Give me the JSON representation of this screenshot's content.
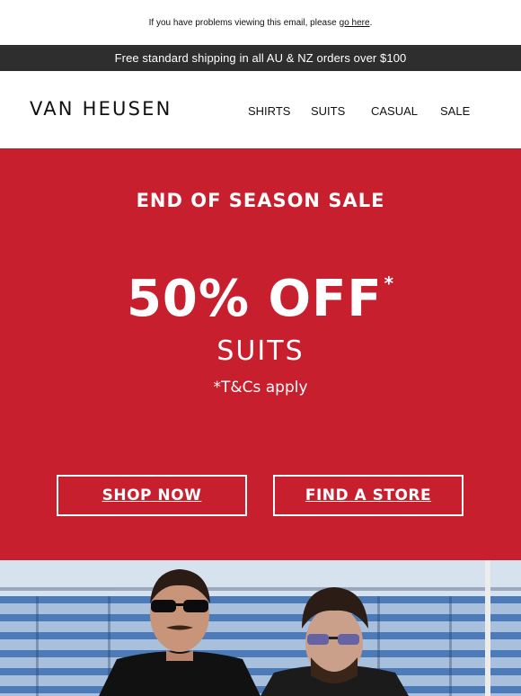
{
  "preheader": {
    "text": "If you have problems viewing this email, please",
    "link": "go here",
    "tail": "."
  },
  "shipping_bar": {
    "text": "Free standard shipping in all AU & NZ orders over $100"
  },
  "header": {
    "logo": "VAN HEUSEN",
    "nav": [
      {
        "label": "SHIRTS"
      },
      {
        "label": "SUITS"
      },
      {
        "label": "CASUAL"
      },
      {
        "label": "SALE"
      }
    ]
  },
  "hero": {
    "eyebrow": "END OF SEASON SALE",
    "headline": "50% OFF",
    "headline_mark": "*",
    "subhead": "SUITS",
    "terms": "*T&Cs apply",
    "buttons": {
      "shop": "SHOP NOW",
      "store": "FIND A STORE"
    },
    "background_color": "#c71f2d"
  },
  "colors": {
    "shipping_bar_bg": "#2e2e2e",
    "hero_red": "#c71f2d"
  }
}
